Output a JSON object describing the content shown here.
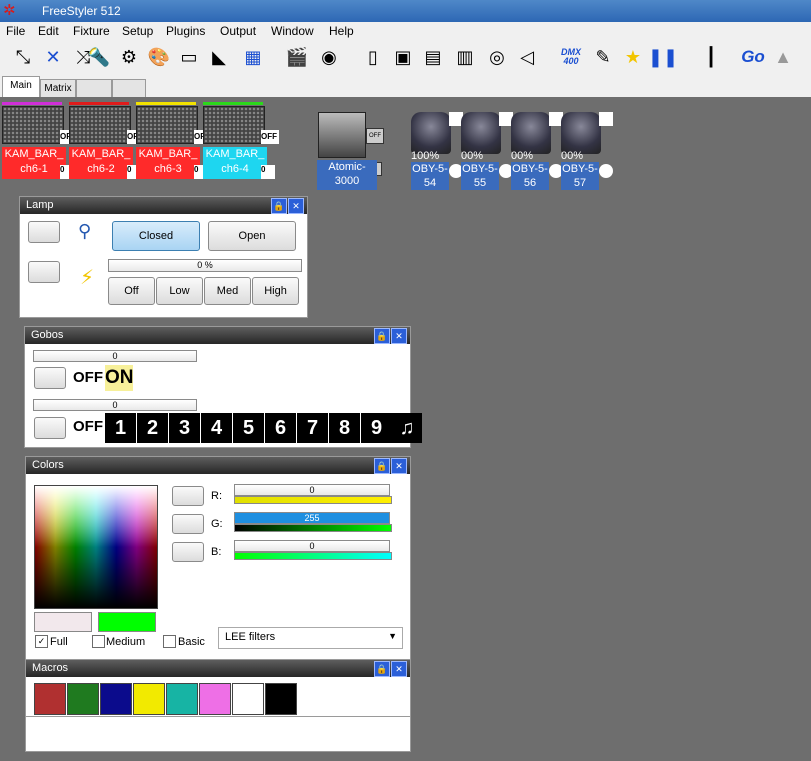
{
  "window": {
    "title": "FreeStyler 512"
  },
  "menu": [
    "File",
    "Edit",
    "Fixture",
    "Setup",
    "Plugins",
    "Output",
    "Window",
    "Help"
  ],
  "toolbar": {
    "dmx_label": "DMX",
    "dmx_sub": "400",
    "go_label": "Go"
  },
  "tabs": [
    "Main",
    "Matrix",
    "",
    ""
  ],
  "fixtures": {
    "bars": [
      {
        "line1": "KAM_BAR_",
        "line2": "ch6-1",
        "off": "OFF",
        "zero": "0",
        "color": "#ff2a2a",
        "top": "#d02ed8"
      },
      {
        "line1": "KAM_BAR_",
        "line2": "ch6-2",
        "off": "OFF",
        "zero": "0",
        "color": "#ff2a2a",
        "top": "#e01c1c"
      },
      {
        "line1": "KAM_BAR_",
        "line2": "ch6-3",
        "off": "OFF",
        "zero": "0",
        "color": "#ff2a2a",
        "top": "#f2e200"
      },
      {
        "line1": "KAM_BAR_",
        "line2": "ch6-4",
        "off": "OFF",
        "zero": "0",
        "color": "#1ed6f0",
        "top": "#2bd81b"
      }
    ],
    "atomic": {
      "line1": "Atomic-",
      "line2": "3000",
      "off": "OFF"
    },
    "movers": [
      {
        "pct": "100%",
        "line1": "OBY-5-",
        "line2": "54"
      },
      {
        "pct": "00%",
        "line1": "OBY-5-",
        "line2": "55"
      },
      {
        "pct": "00%",
        "line1": "OBY-5-",
        "line2": "56"
      },
      {
        "pct": "00%",
        "line1": "OBY-5-",
        "line2": "57"
      }
    ]
  },
  "lamp": {
    "title": "Lamp",
    "closed": "Closed",
    "open": "Open",
    "dimmer_value": "0 %",
    "levels": [
      "Off",
      "Low",
      "Med",
      "High"
    ]
  },
  "gobos": {
    "title": "Gobos",
    "slider1": "0",
    "slider2": "0",
    "off1": "OFF",
    "on1": "ON",
    "off2": "OFF",
    "numbers": [
      "1",
      "2",
      "3",
      "4",
      "5",
      "6",
      "7",
      "8",
      "9"
    ]
  },
  "colors": {
    "title": "Colors",
    "r_label": "R:",
    "g_label": "G:",
    "b_label": "B:",
    "r_value": "0",
    "g_value": "255",
    "b_value": "0",
    "r_fill": 0,
    "g_fill": 1,
    "b_fill": 0,
    "full": "Full",
    "medium": "Medium",
    "basic": "Basic",
    "filter": "LEE filters",
    "current": "#00ff00"
  },
  "macros": {
    "title": "Macros",
    "swatches": [
      "#b03030",
      "#1f7a1f",
      "#0b0b8c",
      "#f2ea00",
      "#17b4a4",
      "#ee6fe6",
      "#ffffff",
      "#000000"
    ]
  }
}
